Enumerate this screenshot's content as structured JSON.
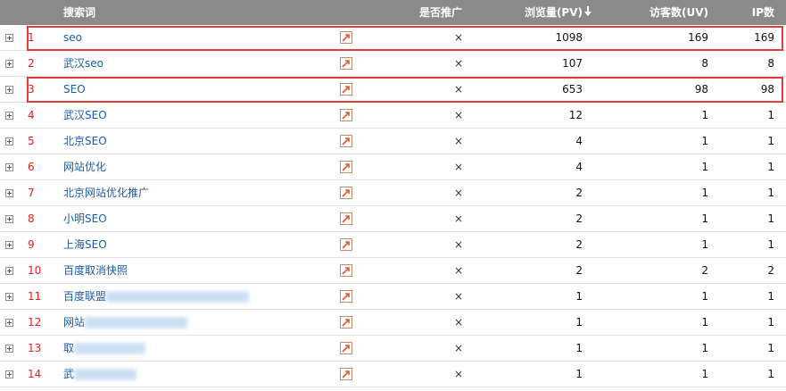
{
  "header": {
    "keyword": "搜索词",
    "promoted": "是否推广",
    "pageviews": "浏览量(PV)",
    "sort_icon": "sort-desc-arrow",
    "visitors": "访客数(UV)",
    "ip": "IP数"
  },
  "rows": [
    {
      "rank": "1",
      "term": "seo",
      "promoted": "×",
      "pv": "1098",
      "uv": "169",
      "ip": "169",
      "highlighted": true
    },
    {
      "rank": "2",
      "term": "武汉seo",
      "promoted": "×",
      "pv": "107",
      "uv": "8",
      "ip": "8"
    },
    {
      "rank": "3",
      "term": "SEO",
      "promoted": "×",
      "pv": "653",
      "uv": "98",
      "ip": "98",
      "highlighted": true
    },
    {
      "rank": "4",
      "term": "武汉SEO",
      "promoted": "×",
      "pv": "12",
      "uv": "1",
      "ip": "1"
    },
    {
      "rank": "5",
      "term": "北京SEO",
      "promoted": "×",
      "pv": "4",
      "uv": "1",
      "ip": "1"
    },
    {
      "rank": "6",
      "term": "网站优化",
      "promoted": "×",
      "pv": "4",
      "uv": "1",
      "ip": "1"
    },
    {
      "rank": "7",
      "term": "北京网站优化推广",
      "promoted": "×",
      "pv": "2",
      "uv": "1",
      "ip": "1"
    },
    {
      "rank": "8",
      "term": "小明SEO",
      "promoted": "×",
      "pv": "2",
      "uv": "1",
      "ip": "1"
    },
    {
      "rank": "9",
      "term": "上海SEO",
      "promoted": "×",
      "pv": "2",
      "uv": "1",
      "ip": "1"
    },
    {
      "rank": "10",
      "term": "百度取消快照",
      "promoted": "×",
      "pv": "2",
      "uv": "2",
      "ip": "2"
    },
    {
      "rank": "11",
      "term": "百度联盟",
      "promoted": "×",
      "pv": "1",
      "uv": "1",
      "ip": "1",
      "blurred": true
    },
    {
      "rank": "12",
      "term": "网站",
      "promoted": "×",
      "pv": "1",
      "uv": "1",
      "ip": "1",
      "blurred": true
    },
    {
      "rank": "13",
      "term": "取",
      "promoted": "×",
      "pv": "1",
      "uv": "1",
      "ip": "1",
      "blurred": true
    },
    {
      "rank": "14",
      "term": "武",
      "promoted": "×",
      "pv": "1",
      "uv": "1",
      "ip": "1",
      "blurred": true
    }
  ],
  "colors": {
    "header_bg": "#8a8a8a",
    "rank": "#e02020",
    "term_link": "#1a5ba8",
    "highlight": "#e53a3a"
  }
}
